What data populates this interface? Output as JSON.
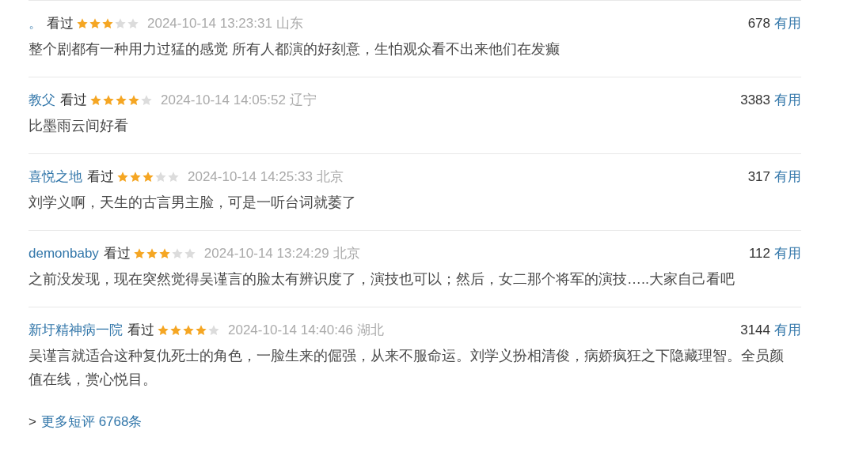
{
  "comments": [
    {
      "user": "。",
      "status": "看过",
      "stars": 3,
      "time": "2024-10-14 13:23:31",
      "location": "山东",
      "votes": "678",
      "useful": "有用",
      "text": "整个剧都有一种用力过猛的感觉 所有人都演的好刻意，生怕观众看不出来他们在发癫"
    },
    {
      "user": "教父",
      "status": "看过",
      "stars": 4,
      "time": "2024-10-14 14:05:52",
      "location": "辽宁",
      "votes": "3383",
      "useful": "有用",
      "text": "比墨雨云间好看"
    },
    {
      "user": "喜悦之地",
      "status": "看过",
      "stars": 3,
      "time": "2024-10-14 14:25:33",
      "location": "北京",
      "votes": "317",
      "useful": "有用",
      "text": "刘学义啊，天生的古言男主脸，可是一听台词就萎了"
    },
    {
      "user": "demonbaby",
      "status": "看过",
      "stars": 3,
      "time": "2024-10-14 13:24:29",
      "location": "北京",
      "votes": "112",
      "useful": "有用",
      "text": "之前没发现，现在突然觉得吴谨言的脸太有辨识度了，演技也可以；然后，女二那个将军的演技…..大家自己看吧"
    },
    {
      "user": "新圩精神病一院",
      "status": "看过",
      "stars": 4,
      "time": "2024-10-14 14:40:46",
      "location": "湖北",
      "votes": "3144",
      "useful": "有用",
      "text": "吴谨言就适合这种复仇死士的角色，一脸生来的倔强，从来不服命运。刘学义扮相清俊，病娇疯狂之下隐藏理智。全员颜值在线，赏心悦目。"
    }
  ],
  "more": {
    "arrow": ">",
    "label": "更多短评 6768条"
  }
}
